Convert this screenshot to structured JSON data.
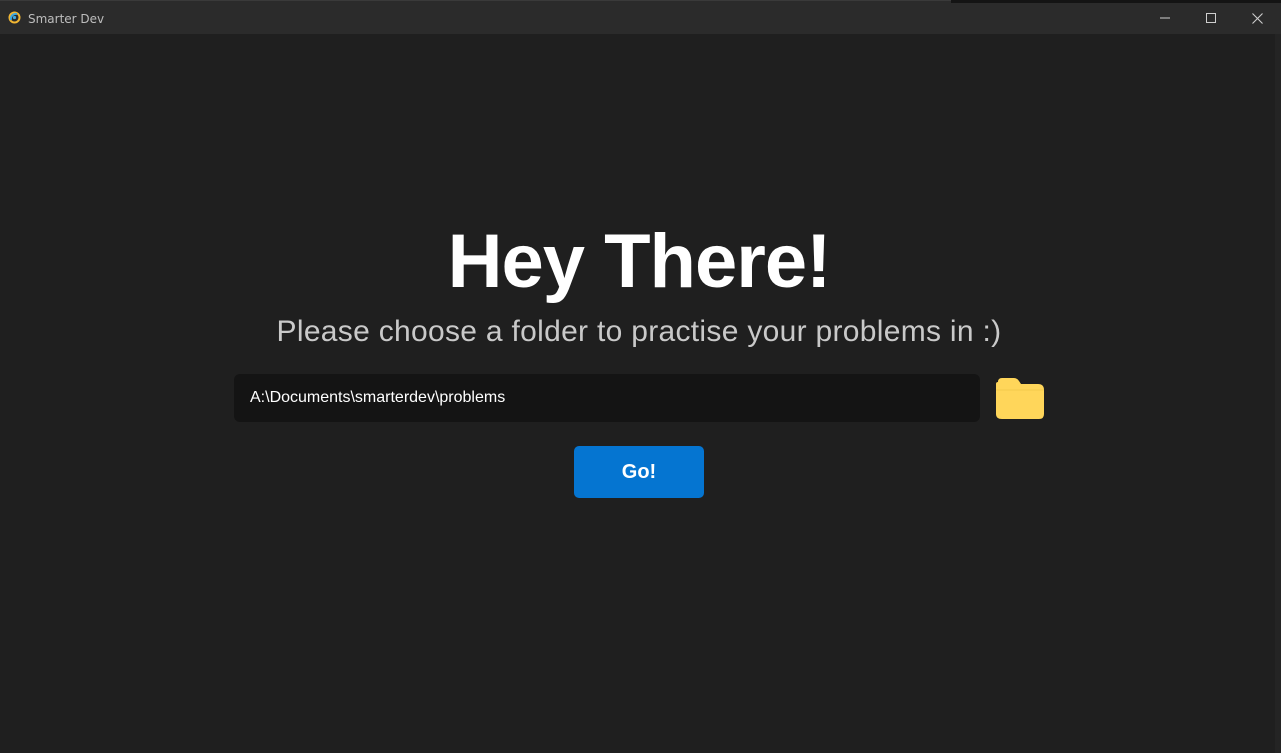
{
  "window": {
    "title": "Smarter Dev"
  },
  "main": {
    "heading": "Hey There!",
    "subheading": "Please choose a folder to practise your problems in :)",
    "folder_path": "A:\\Documents\\smarterdev\\problems",
    "go_label": "Go!"
  },
  "icons": {
    "app": "app-logo-icon",
    "folder": "folder-icon",
    "minimize": "minimize-icon",
    "maximize": "maximize-icon",
    "close": "close-icon"
  },
  "colors": {
    "background": "#1f1f1f",
    "titlebar": "#2b2b2b",
    "input_background": "#141414",
    "accent": "#0575d1",
    "folder": "#ffd65a"
  }
}
